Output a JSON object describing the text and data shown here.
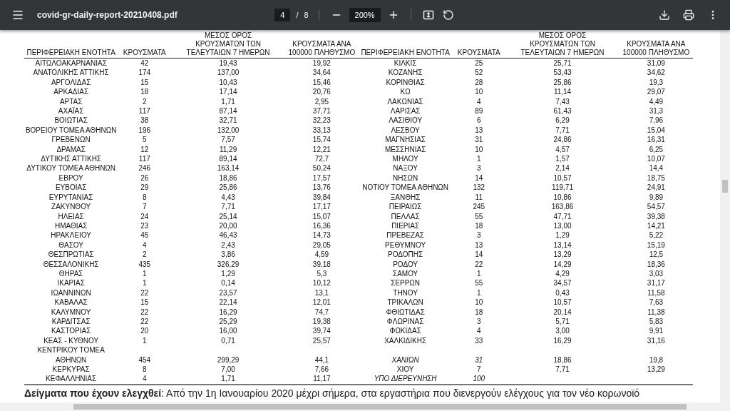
{
  "toolbar": {
    "title": "covid-gr-daily-report-20210408.pdf",
    "page": "4",
    "separator": "/",
    "page_count": "8",
    "zoom": "200%"
  },
  "tables": [
    {
      "columns": [
        "ΠΕΡΙΦΕΡΕΙΑΚΗ ΕΝΟΤΗΤΑ",
        "ΚΡΟΥΣΜΑΤΑ",
        "ΜΕΣΟΣ ΟΡΟΣ ΚΡΟΥΣΜΑΤΩΝ ΤΩΝ ΤΕΛΕΥΤΑΙΩΝ 7 ΗΜΕΡΩΝ",
        "ΚΡΟΥΣΜΑΤΑ ΑΝΑ 100000 ΠΛΗΘΥΣΜΟ"
      ],
      "rows": [
        {
          "region": "ΑΙΤΩΛΟΑΚΑΡΝΑΝΙΑΣ",
          "cases": "42",
          "avg_7d": "19,43",
          "per_100k": "19,92"
        },
        {
          "region": "ΑΝΑΤΟΛΙΚΗΣ ΑΤΤΙΚΗΣ",
          "cases": "174",
          "avg_7d": "137,00",
          "per_100k": "34,64"
        },
        {
          "region": "ΑΡΓΟΛΙΔΑΣ",
          "cases": "15",
          "avg_7d": "10,43",
          "per_100k": "15,46"
        },
        {
          "region": "ΑΡΚΑΔΙΑΣ",
          "cases": "18",
          "avg_7d": "17,14",
          "per_100k": "20,76"
        },
        {
          "region": "ΑΡΤΑΣ",
          "cases": "2",
          "avg_7d": "1,71",
          "per_100k": "2,95"
        },
        {
          "region": "ΑΧΑΪΑΣ",
          "cases": "117",
          "avg_7d": "87,14",
          "per_100k": "37,71"
        },
        {
          "region": "ΒΟΙΩΤΙΑΣ",
          "cases": "38",
          "avg_7d": "32,71",
          "per_100k": "32,23"
        },
        {
          "region": "ΒΟΡΕΙΟΥ ΤΟΜΕΑ ΑΘΗΝΩΝ",
          "cases": "196",
          "avg_7d": "132,00",
          "per_100k": "33,13"
        },
        {
          "region": "ΓΡΕΒΕΝΩΝ",
          "cases": "5",
          "avg_7d": "7,57",
          "per_100k": "15,74"
        },
        {
          "region": "ΔΡΑΜΑΣ",
          "cases": "12",
          "avg_7d": "11,29",
          "per_100k": "12,21"
        },
        {
          "region": "ΔΥΤΙΚΗΣ ΑΤΤΙΚΗΣ",
          "cases": "117",
          "avg_7d": "89,14",
          "per_100k": "72,7"
        },
        {
          "region": "ΔΥΤΙΚΟΥ ΤΟΜΕΑ ΑΘΗΝΩΝ",
          "cases": "246",
          "avg_7d": "163,14",
          "per_100k": "50,24"
        },
        {
          "region": "ΕΒΡΟΥ",
          "cases": "26",
          "avg_7d": "18,86",
          "per_100k": "17,57"
        },
        {
          "region": "ΕΥΒΟΙΑΣ",
          "cases": "29",
          "avg_7d": "25,86",
          "per_100k": "13,76"
        },
        {
          "region": "ΕΥΡΥΤΑΝΙΑΣ",
          "cases": "8",
          "avg_7d": "4,43",
          "per_100k": "39,84"
        },
        {
          "region": "ΖΑΚΥΝΘΟΥ",
          "cases": "7",
          "avg_7d": "7,71",
          "per_100k": "17,17"
        },
        {
          "region": "ΗΛΕΙΑΣ",
          "cases": "24",
          "avg_7d": "25,14",
          "per_100k": "15,07"
        },
        {
          "region": "ΗΜΑΘΙΑΣ",
          "cases": "23",
          "avg_7d": "20,00",
          "per_100k": "16,36"
        },
        {
          "region": "ΗΡΑΚΛΕΙΟΥ",
          "cases": "45",
          "avg_7d": "46,43",
          "per_100k": "14,73"
        },
        {
          "region": "ΘΑΣΟΥ",
          "cases": "4",
          "avg_7d": "2,43",
          "per_100k": "29,05"
        },
        {
          "region": "ΘΕΣΠΡΩΤΙΑΣ",
          "cases": "2",
          "avg_7d": "3,86",
          "per_100k": "4,59"
        },
        {
          "region": "ΘΕΣΣΑΛΟΝΙΚΗΣ",
          "cases": "435",
          "avg_7d": "326,29",
          "per_100k": "39,18"
        },
        {
          "region": "ΘΗΡΑΣ",
          "cases": "1",
          "avg_7d": "1,29",
          "per_100k": "5,3"
        },
        {
          "region": "ΙΚΑΡΙΑΣ",
          "cases": "1",
          "avg_7d": "0,14",
          "per_100k": "10,12"
        },
        {
          "region": "ΙΩΑΝΝΙΝΩΝ",
          "cases": "22",
          "avg_7d": "23,57",
          "per_100k": "13,1"
        },
        {
          "region": "ΚΑΒΑΛΑΣ",
          "cases": "15",
          "avg_7d": "22,14",
          "per_100k": "12,01"
        },
        {
          "region": "ΚΑΛΥΜΝΟΥ",
          "cases": "22",
          "avg_7d": "16,29",
          "per_100k": "74,7"
        },
        {
          "region": "ΚΑΡΔΙΤΣΑΣ",
          "cases": "22",
          "avg_7d": "25,29",
          "per_100k": "19,38"
        },
        {
          "region": "ΚΑΣΤΟΡΙΑΣ",
          "cases": "20",
          "avg_7d": "16,00",
          "per_100k": "39,74"
        },
        {
          "region": "ΚΕΑΣ - ΚΥΘΝΟΥ",
          "cases": "1",
          "avg_7d": "0,71",
          "per_100k": "25,57"
        },
        {
          "region": "ΚΕΝΤΡΙΚΟΥ ΤΟΜΕΑ\nΑΘΗΝΩΝ",
          "cases": "454",
          "avg_7d": "299,29",
          "per_100k": "44,1"
        },
        {
          "region": "ΚΕΡΚΥΡΑΣ",
          "cases": "8",
          "avg_7d": "7,00",
          "per_100k": "7,66"
        },
        {
          "region": "ΚΕΦΑΛΛΗΝΙΑΣ",
          "cases": "4",
          "avg_7d": "1,71",
          "per_100k": "11,17"
        }
      ]
    },
    {
      "columns": [
        "ΠΕΡΙΦΕΡΕΙΑΚΗ ΕΝΟΤΗΤΑ",
        "ΚΡΟΥΣΜΑΤΑ",
        "ΜΕΣΟΣ ΟΡΟΣ ΚΡΟΥΣΜΑΤΩΝ ΤΩΝ ΤΕΛΕΥΤΑΙΩΝ 7 ΗΜΕΡΩΝ",
        "ΚΡΟΥΣΜΑΤΑ ΑΝΑ 100000 ΠΛΗΘΥΣΜΟ"
      ],
      "rows": [
        {
          "region": "ΚΙΛΚΙΣ",
          "cases": "25",
          "avg_7d": "25,71",
          "per_100k": "31,09",
          "italic": false
        },
        {
          "region": "ΚΟΖΑΝΗΣ",
          "cases": "52",
          "avg_7d": "53,43",
          "per_100k": "34,62",
          "italic": false
        },
        {
          "region": "ΚΟΡΙΝΘΙΑΣ",
          "cases": "28",
          "avg_7d": "25,86",
          "per_100k": "19,3",
          "italic": false
        },
        {
          "region": "ΚΩ",
          "cases": "10",
          "avg_7d": "11,14",
          "per_100k": "29,07",
          "italic": false
        },
        {
          "region": "ΛΑΚΩΝΙΑΣ",
          "cases": "4",
          "avg_7d": "7,43",
          "per_100k": "4,49",
          "italic": false
        },
        {
          "region": "ΛΑΡΙΣΑΣ",
          "cases": "89",
          "avg_7d": "61,43",
          "per_100k": "31,3",
          "italic": false
        },
        {
          "region": "ΛΑΣΙΘΙΟΥ",
          "cases": "6",
          "avg_7d": "6,29",
          "per_100k": "7,96",
          "italic": false
        },
        {
          "region": "ΛΕΣΒΟΥ",
          "cases": "13",
          "avg_7d": "7,71",
          "per_100k": "15,04",
          "italic": false
        },
        {
          "region": "ΜΑΓΝΗΣΙΑΣ",
          "cases": "31",
          "avg_7d": "24,86",
          "per_100k": "16,31",
          "italic": false
        },
        {
          "region": "ΜΕΣΣΗΝΙΑΣ",
          "cases": "10",
          "avg_7d": "4,57",
          "per_100k": "6,25",
          "italic": false
        },
        {
          "region": "ΜΗΛΟΥ",
          "cases": "1",
          "avg_7d": "1,57",
          "per_100k": "10,07",
          "italic": false
        },
        {
          "region": "ΝΑΞΟΥ",
          "cases": "3",
          "avg_7d": "2,14",
          "per_100k": "14,4",
          "italic": false
        },
        {
          "region": "ΝΗΣΩΝ",
          "cases": "14",
          "avg_7d": "10,57",
          "per_100k": "18,75",
          "italic": false
        },
        {
          "region": "ΝΟΤΙΟΥ ΤΟΜΕΑ ΑΘΗΝΩΝ",
          "cases": "132",
          "avg_7d": "119,71",
          "per_100k": "24,91",
          "italic": false
        },
        {
          "region": "ΞΑΝΘΗΣ",
          "cases": "11",
          "avg_7d": "10,86",
          "per_100k": "9,89",
          "italic": false
        },
        {
          "region": "ΠΕΙΡΑΙΩΣ",
          "cases": "245",
          "avg_7d": "163,86",
          "per_100k": "54,57",
          "italic": false
        },
        {
          "region": "ΠΕΛΛΑΣ",
          "cases": "55",
          "avg_7d": "47,71",
          "per_100k": "39,38",
          "italic": false
        },
        {
          "region": "ΠΙΕΡΙΑΣ",
          "cases": "18",
          "avg_7d": "13,00",
          "per_100k": "14,21",
          "italic": false
        },
        {
          "region": "ΠΡΕΒΕΖΑΣ",
          "cases": "3",
          "avg_7d": "1,29",
          "per_100k": "5,22",
          "italic": false
        },
        {
          "region": "ΡΕΘΥΜΝΟΥ",
          "cases": "13",
          "avg_7d": "13,14",
          "per_100k": "15,19",
          "italic": false
        },
        {
          "region": "ΡΟΔΟΠΗΣ",
          "cases": "14",
          "avg_7d": "13,29",
          "per_100k": "12,5",
          "italic": false
        },
        {
          "region": "ΡΟΔΟΥ",
          "cases": "22",
          "avg_7d": "14,29",
          "per_100k": "18,36",
          "italic": false
        },
        {
          "region": "ΣΑΜΟΥ",
          "cases": "1",
          "avg_7d": "4,29",
          "per_100k": "3,03",
          "italic": false
        },
        {
          "region": "ΣΕΡΡΩΝ",
          "cases": "55",
          "avg_7d": "34,57",
          "per_100k": "31,17",
          "italic": false
        },
        {
          "region": "ΤΗΝΟΥ",
          "cases": "1",
          "avg_7d": "0,43",
          "per_100k": "11,58",
          "italic": false
        },
        {
          "region": "ΤΡΙΚΑΛΩΝ",
          "cases": "10",
          "avg_7d": "10,57",
          "per_100k": "7,63",
          "italic": false
        },
        {
          "region": "ΦΘΙΩΤΙΔΑΣ",
          "cases": "18",
          "avg_7d": "20,14",
          "per_100k": "11,38",
          "italic": false
        },
        {
          "region": "ΦΛΩΡΙΝΑΣ",
          "cases": "3",
          "avg_7d": "5,71",
          "per_100k": "5,83",
          "italic": false
        },
        {
          "region": "ΦΩΚΙΔΑΣ",
          "cases": "4",
          "avg_7d": "3,00",
          "per_100k": "9,91",
          "italic": false
        },
        {
          "region": "ΧΑΛΚΙΔΙΚΗΣ",
          "cases": "33",
          "avg_7d": "16,29",
          "per_100k": "31,16",
          "italic": false
        },
        {
          "region": "ΧΑΝΙΩΝ",
          "cases": "31",
          "avg_7d": "18,86",
          "per_100k": "19,8",
          "italic": true
        },
        {
          "region": "ΧΙΟΥ",
          "cases": "7",
          "avg_7d": "7,71",
          "per_100k": "13,29",
          "italic": false
        },
        {
          "region": "ΥΠΟ ΔΙΕΡΕΥΝΗΣΗ",
          "cases": "100",
          "italic": true
        }
      ]
    }
  ],
  "footnote": "**Δείγματα που έχουν ελεγχθεί**: Από την 1η Ιανουαρίου 2020 μέχρι σήμερα, στα εργαστήρια που διενεργούν ελέγχους για τον νέο κορωνοϊό"
}
